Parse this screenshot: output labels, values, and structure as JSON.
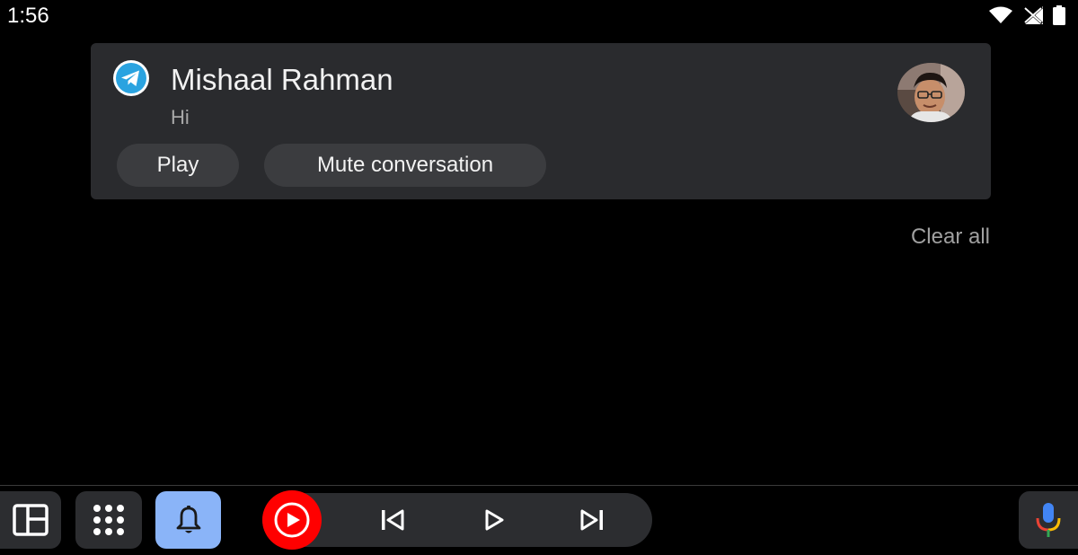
{
  "status_bar": {
    "time": "1:56",
    "icons": [
      "wifi-icon",
      "no-signal-icon",
      "battery-icon"
    ]
  },
  "notification": {
    "app_icon": "telegram-icon",
    "sender": "Mishaal Rahman",
    "message": "Hi",
    "avatar": "contact-avatar",
    "actions": {
      "play_label": "Play",
      "mute_label": "Mute conversation"
    }
  },
  "clear_all_label": "Clear all",
  "bottom_bar": {
    "buttons": [
      "split-view-icon",
      "app-grid-icon",
      "bell-icon"
    ],
    "active_button": "bell-icon",
    "media": {
      "app_icon": "youtube-music-icon",
      "controls": [
        "skip-previous-icon",
        "play-icon",
        "skip-next-icon"
      ]
    },
    "assistant": "microphone-icon"
  },
  "colors": {
    "card": "#2a2b2e",
    "chip": "#3b3c3f",
    "active_accent": "#8ab4f8",
    "youtube_red": "#ff0000",
    "telegram_blue": "#2aa3e0"
  }
}
